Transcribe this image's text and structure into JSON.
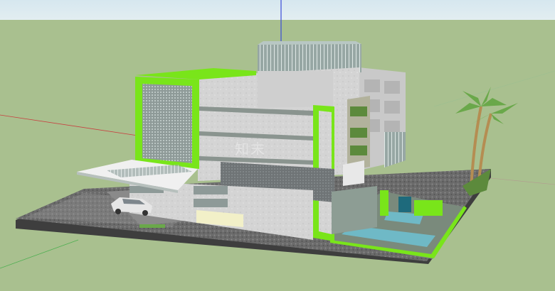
{
  "scene": {
    "colors": {
      "sky_top": "#d6e7ef",
      "sky_bottom": "#e2eef2",
      "ground": "#a9c08f",
      "accent_green": "#79e51a",
      "axis_blue": "#3b4bd8",
      "axis_red": "#c84040",
      "axis_green": "#4caf50",
      "wall_light": "#d9d9d9",
      "paving": "#6d6d6d",
      "water": "#6fb9c6"
    },
    "watermark": "知末"
  }
}
